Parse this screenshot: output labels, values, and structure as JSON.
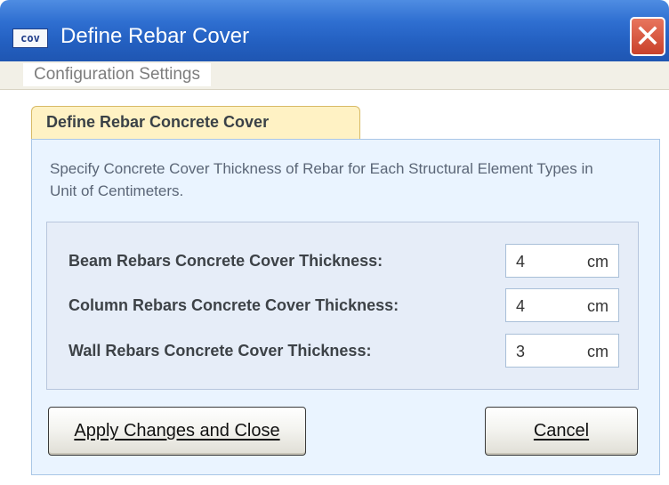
{
  "window": {
    "app_icon_text": "cov",
    "title": "Define Rebar Cover",
    "close_symbol": "✕"
  },
  "menu": {
    "items": [
      "Configuration Settings"
    ]
  },
  "tab": {
    "label": "Define Rebar Concrete Cover"
  },
  "description": "Specify Concrete Cover Thickness of Rebar for Each Structural Element Types in Unit of Centimeters.",
  "fields": [
    {
      "label": "Beam Rebars Concrete Cover Thickness:",
      "value": "4",
      "unit": "cm"
    },
    {
      "label": "Column Rebars Concrete Cover Thickness:",
      "value": "4",
      "unit": "cm"
    },
    {
      "label": "Wall Rebars Concrete Cover Thickness:",
      "value": "3",
      "unit": "cm"
    }
  ],
  "buttons": {
    "apply_label": "Apply Changes and Close",
    "cancel_label": "Cancel"
  }
}
